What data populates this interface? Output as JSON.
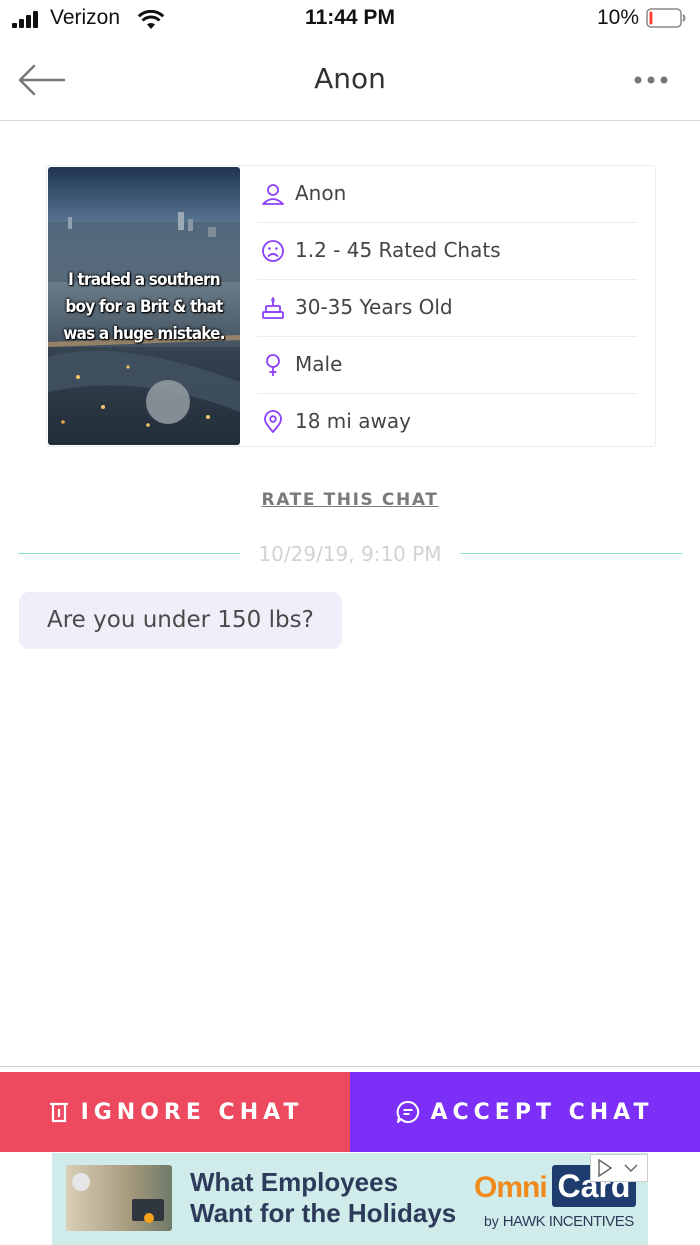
{
  "status_bar": {
    "carrier": "Verizon",
    "time": "11:44 PM",
    "battery_percent": "10%",
    "battery_level": 0.1,
    "colors": {
      "battery_low": "#ff3b30"
    }
  },
  "nav": {
    "title": "Anon",
    "back_icon": "arrow-left-icon",
    "more_icon": "ellipsis-icon"
  },
  "profile": {
    "image_caption": "I traded a southern boy for a Brit & that was a huge mistake.",
    "details": [
      {
        "icon": "person-icon",
        "label": "Anon"
      },
      {
        "icon": "sad-face-icon",
        "label": "1.2 - 45 Rated Chats"
      },
      {
        "icon": "cake-icon",
        "label": "30-35 Years Old"
      },
      {
        "icon": "male-gender-icon",
        "label": "Male"
      },
      {
        "icon": "location-pin-icon",
        "label": "18 mi away"
      }
    ]
  },
  "rate_link": "RATE THIS CHAT",
  "chat": {
    "timestamp": "10/29/19, 9:10 PM",
    "messages": [
      {
        "text": "Are you under 150 lbs?"
      }
    ]
  },
  "actions": {
    "ignore_label": "IGNORE CHAT",
    "accept_label": "ACCEPT CHAT",
    "ignore_icon": "trash-icon",
    "accept_icon": "chat-bubble-icon",
    "colors": {
      "ignore": "#ee4a5f",
      "accept": "#7b2ff7",
      "accent": "#8a3ffc"
    }
  },
  "ad": {
    "headline": "What Employees Want for the Holidays",
    "brand_part1": "Omni",
    "brand_part2": "Card",
    "byline_prefix": "by",
    "byline_brand": "HAWK INCENTIVES"
  }
}
